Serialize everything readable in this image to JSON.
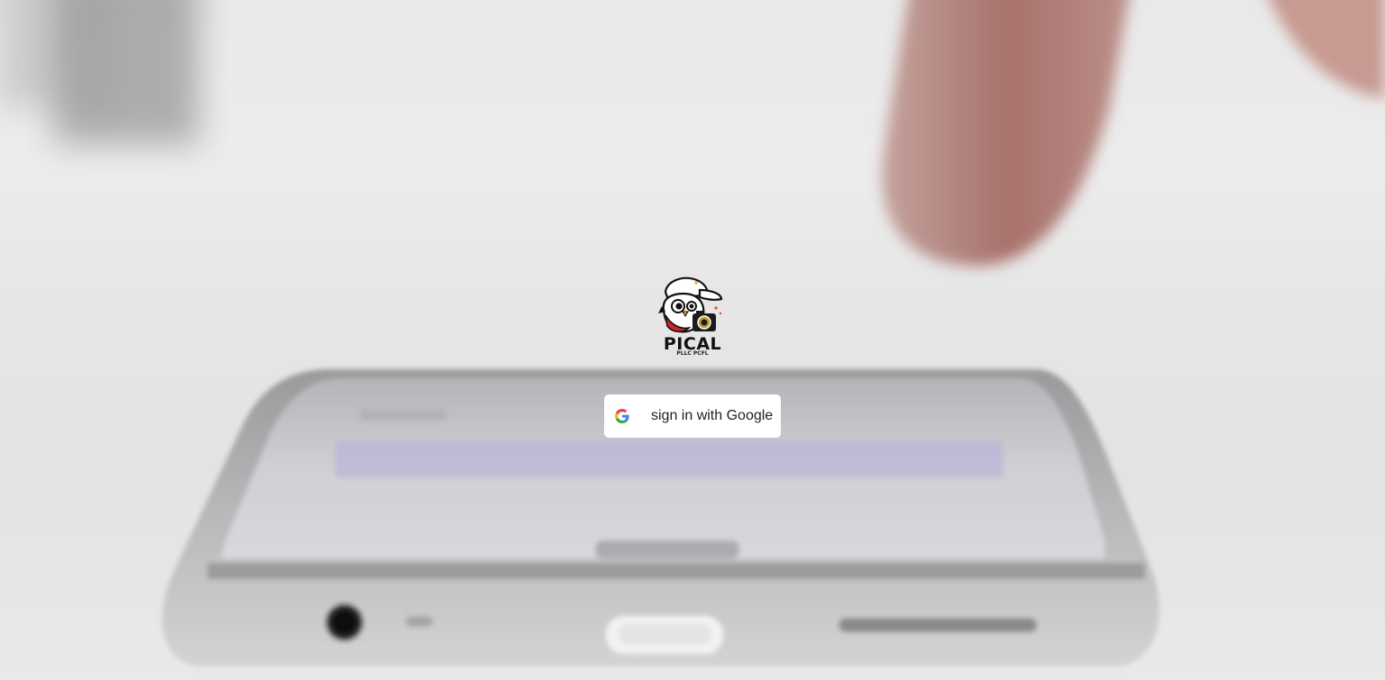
{
  "background": {
    "description_icon": "phone-on-table-photo-icon"
  },
  "logo": {
    "wordmark": "PICAL",
    "tagline": "PLLC PCFL",
    "icon": "bird-with-camera-icon"
  },
  "signin": {
    "label": "sign in with Google",
    "icon": "google-g-icon",
    "colors": {
      "blue": "#4285F4",
      "red": "#EA4335",
      "yellow": "#FBBC05",
      "green": "#34A853"
    }
  }
}
